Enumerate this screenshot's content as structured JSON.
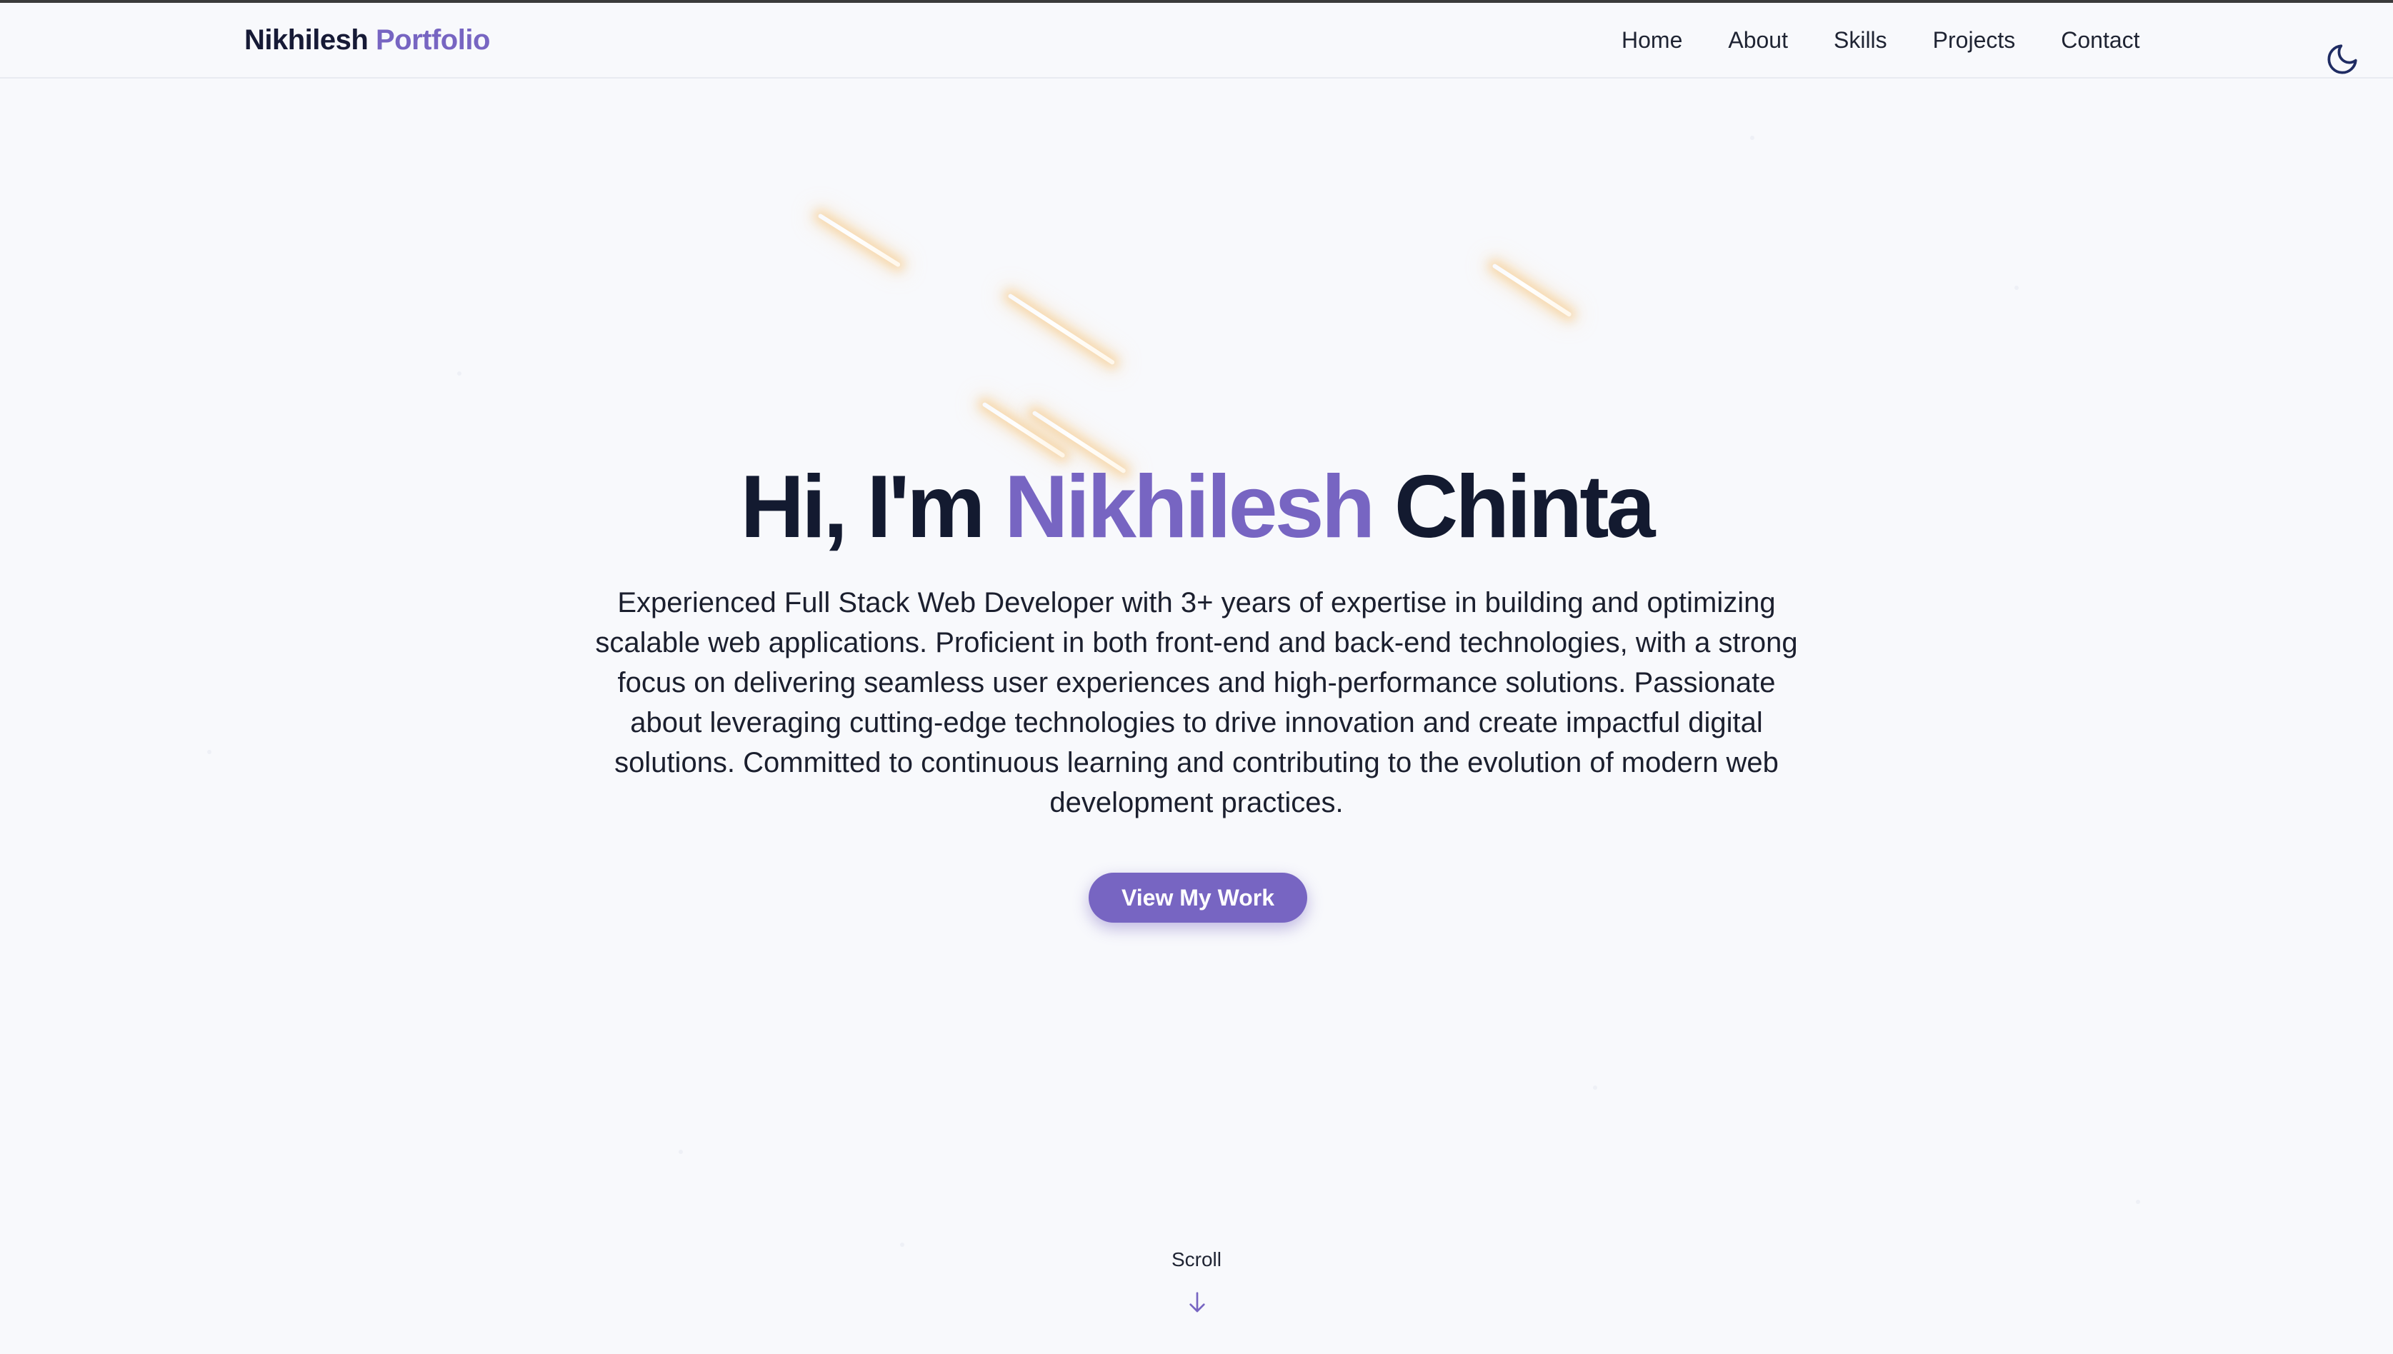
{
  "header": {
    "brand_primary": "Nikhilesh",
    "brand_accent": "Portfolio",
    "nav": [
      {
        "label": "Home"
      },
      {
        "label": "About"
      },
      {
        "label": "Skills"
      },
      {
        "label": "Projects"
      },
      {
        "label": "Contact"
      }
    ],
    "theme_toggle_icon": "moon-icon"
  },
  "hero": {
    "title_prefix": "Hi, I'm",
    "title_name": "Nikhilesh",
    "title_suffix": "Chinta",
    "description": "Experienced Full Stack Web Developer with 3+ years of expertise in building and optimizing scalable web applications. Proficient in both front-end and back-end technologies, with a strong focus on delivering seamless user experiences and high-performance solutions. Passionate about leveraging cutting-edge technologies to drive innovation and create impactful digital solutions. Committed to continuous learning and contributing to the evolution of modern web development practices.",
    "cta_label": "View My Work"
  },
  "scroll": {
    "label": "Scroll",
    "icon": "arrow-down-icon"
  },
  "colors": {
    "accent": "#7765c2",
    "text_dark": "#131a30",
    "background": "#f8f9fc",
    "streak_glow": "#f6c480"
  }
}
